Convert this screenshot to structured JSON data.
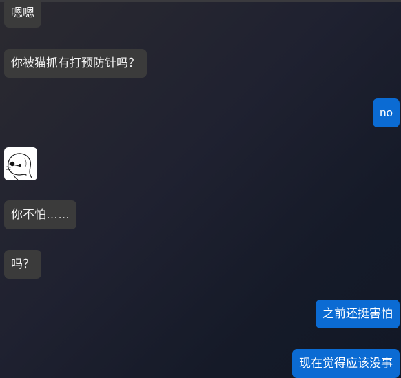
{
  "chat": {
    "messages": [
      {
        "side": "incoming",
        "text": "嗯嗯"
      },
      {
        "side": "incoming",
        "text": "你被猫抓有打预防针吗？"
      },
      {
        "side": "outgoing",
        "text": "no"
      },
      {
        "side": "incoming",
        "sticker": "doodle-creature-sticker"
      },
      {
        "side": "incoming",
        "text": "你不怕……"
      },
      {
        "side": "incoming",
        "text": "吗？"
      },
      {
        "side": "outgoing",
        "text": "之前还挺害怕"
      },
      {
        "side": "outgoing",
        "text": "现在觉得应该没事"
      }
    ]
  },
  "colors": {
    "incoming_bubble": "#3b3b3b",
    "outgoing_bubble": "#0b6bd3",
    "text": "#f2f2f2"
  }
}
